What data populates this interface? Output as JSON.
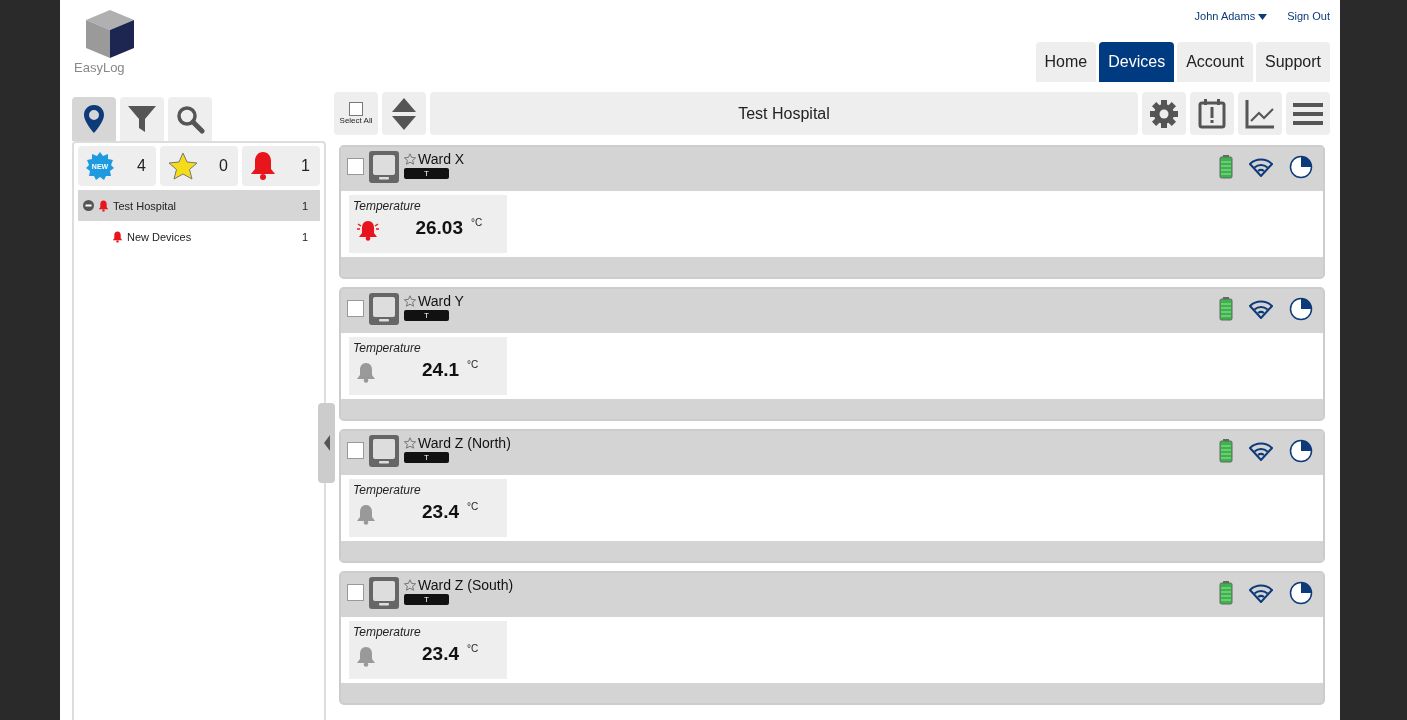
{
  "header": {
    "logo": "EasyLog",
    "user": "John Adams",
    "sign_out": "Sign Out"
  },
  "nav": [
    {
      "label": "Home",
      "selected": false
    },
    {
      "label": "Devices",
      "selected": true
    },
    {
      "label": "Account",
      "selected": false
    },
    {
      "label": "Support",
      "selected": false
    }
  ],
  "sidebar": {
    "tabs": [
      {
        "kind": "location",
        "selected": true
      },
      {
        "kind": "filter",
        "selected": false
      },
      {
        "kind": "search",
        "selected": false
      }
    ],
    "counters": [
      {
        "kind": "new",
        "badge": "NEW",
        "count": "4"
      },
      {
        "kind": "star",
        "count": "0"
      },
      {
        "kind": "alarm",
        "count": "1"
      }
    ],
    "tree": [
      {
        "label": "Test Hospital",
        "count": "1",
        "alarm": true,
        "expanded": true,
        "selected": true,
        "children": [
          {
            "label": "New Devices",
            "count": "1",
            "alarm": true,
            "selected": false
          }
        ]
      }
    ]
  },
  "toolbar": {
    "select_all": "Select All",
    "title": "Test Hospital"
  },
  "devices": [
    {
      "name": "Ward X",
      "tag": "T",
      "checked": false,
      "reading_label": "Temperature",
      "value": "26.03",
      "unit": "°C",
      "alarm": true
    },
    {
      "name": "Ward Y",
      "tag": "T",
      "checked": false,
      "reading_label": "Temperature",
      "value": "24.1",
      "unit": "°C",
      "alarm": false
    },
    {
      "name": "Ward Z (North)",
      "tag": "T",
      "checked": false,
      "reading_label": "Temperature",
      "value": "23.4",
      "unit": "°C",
      "alarm": false
    },
    {
      "name": "Ward Z (South)",
      "tag": "T",
      "checked": false,
      "reading_label": "Temperature",
      "value": "23.4",
      "unit": "°C",
      "alarm": false
    }
  ]
}
